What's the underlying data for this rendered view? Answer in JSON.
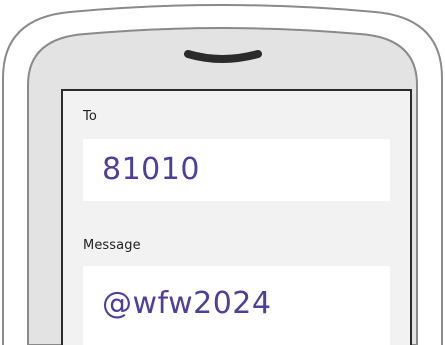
{
  "compose": {
    "to_label": "To",
    "to_value": "81010",
    "message_label": "Message",
    "message_value": "@wfw2024"
  },
  "colors": {
    "value_text": "#4f3f98",
    "label_text": "#1f1f1f",
    "screen_bg": "#f2f2f2",
    "field_bg": "#ffffff",
    "phone_frame": "#e3e3e3",
    "outline": "#7a7a7a",
    "bezel": "#2b2b2b"
  }
}
